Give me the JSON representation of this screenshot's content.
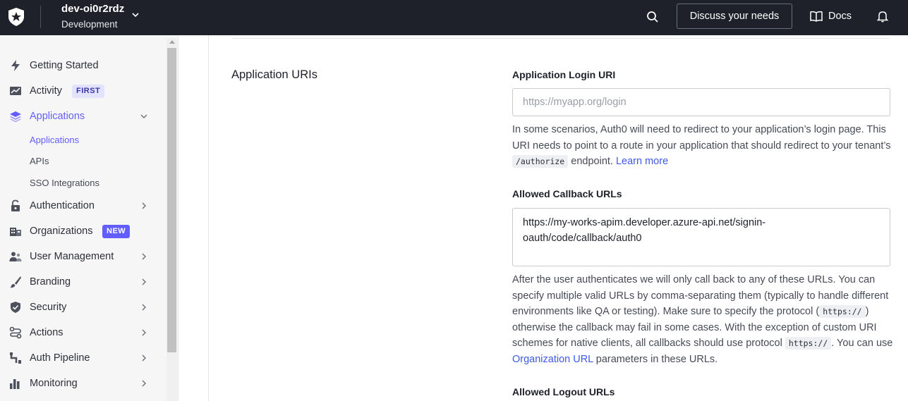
{
  "topbar": {
    "tenant_name": "dev-oi0r2rdz",
    "tenant_env": "Development",
    "discuss_label": "Discuss your needs",
    "docs_label": "Docs"
  },
  "sidebar": {
    "items": [
      {
        "label": "Getting Started",
        "icon": "lightning-icon"
      },
      {
        "label": "Activity",
        "icon": "trend-chart-icon",
        "badge": "FIRST"
      },
      {
        "label": "Applications",
        "icon": "layers-icon",
        "active": true
      },
      {
        "label": "Authentication",
        "icon": "lock-icon"
      },
      {
        "label": "Organizations",
        "icon": "building-icon",
        "badge": "NEW"
      },
      {
        "label": "User Management",
        "icon": "users-icon"
      },
      {
        "label": "Branding",
        "icon": "brush-icon"
      },
      {
        "label": "Security",
        "icon": "shield-icon"
      },
      {
        "label": "Actions",
        "icon": "flow-icon"
      },
      {
        "label": "Auth Pipeline",
        "icon": "pipeline-icon"
      },
      {
        "label": "Monitoring",
        "icon": "bar-chart-icon"
      }
    ],
    "sub_items": [
      "Applications",
      "APIs",
      "SSO Integrations"
    ]
  },
  "main": {
    "section_title": "Application URIs",
    "login_uri": {
      "label": "Application Login URI",
      "placeholder": "https://myapp.org/login",
      "help_1": "In some scenarios, Auth0 will need to redirect to your application’s login page. This URI needs to point to a route in your application that should redirect to your tenant’s",
      "help_code": "/authorize",
      "help_2": "endpoint.",
      "help_link": "Learn more"
    },
    "callback": {
      "label": "Allowed Callback URLs",
      "value": "https://my-works-apim.developer.azure-api.net/signin-oauth/code/callback/auth0",
      "help_1": "After the user authenticates we will only call back to any of these URLs. You can specify multiple valid URLs by comma-separating them (typically to handle different environments like QA or testing). Make sure to specify the protocol (",
      "help_code_1": "https://",
      "help_2": ") otherwise the callback may fail in some cases. With the exception of custom URI schemes for native clients, all callbacks should use protocol",
      "help_code_2": "https://",
      "help_3": ". You can use",
      "help_link": "Organization URL",
      "help_4": "parameters in these URLs."
    },
    "logout": {
      "label": "Allowed Logout URLs"
    }
  },
  "colors": {
    "topbar_bg": "#1e212a",
    "accent": "#635dff",
    "link": "#3f59e4"
  }
}
